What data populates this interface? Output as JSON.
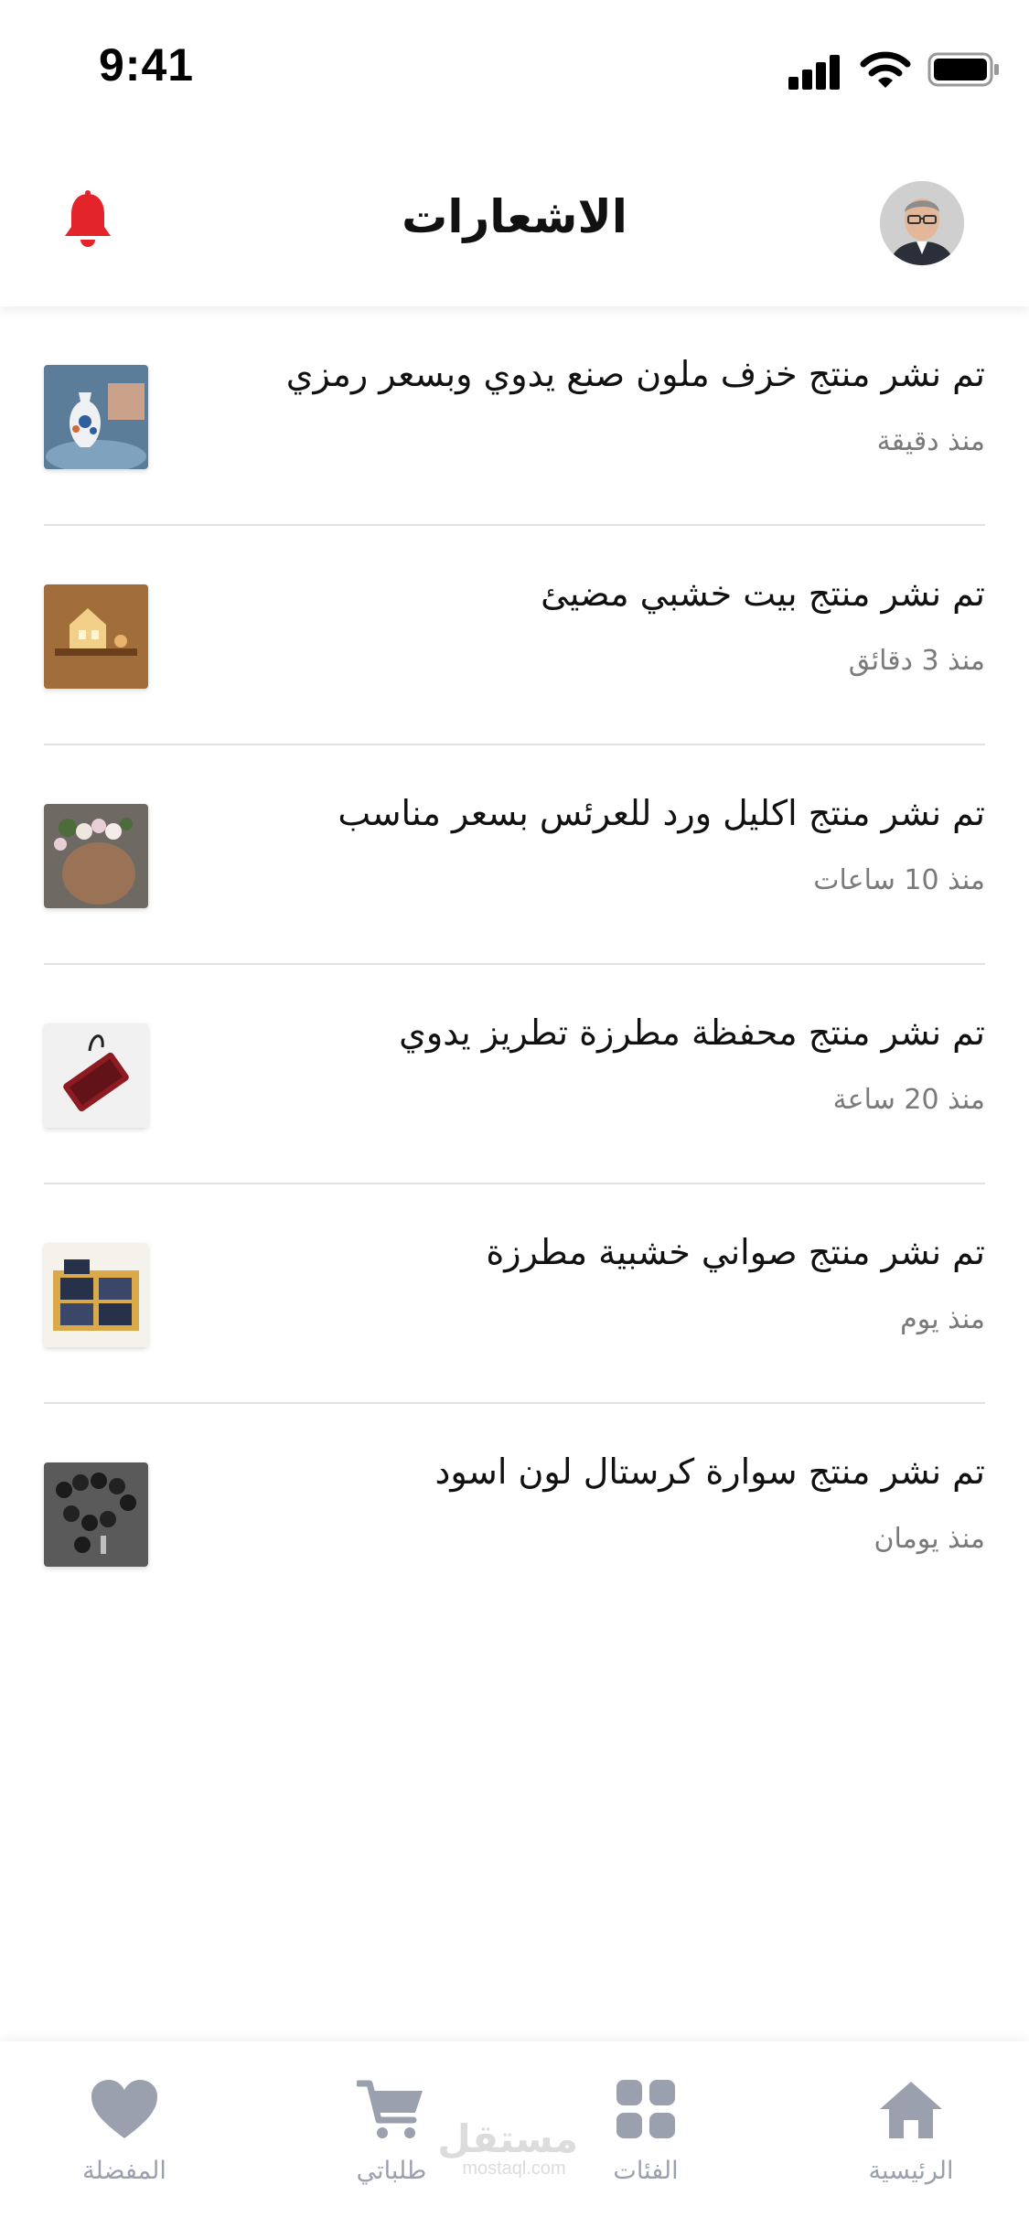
{
  "status_bar": {
    "time": "9:41"
  },
  "header": {
    "title": "الاشعارات"
  },
  "notifications": [
    {
      "title": "تم نشر منتج خزف ملون صنع يدوي وبسعر رمزي",
      "time": "منذ دقيقة",
      "thumb": "pottery-vase"
    },
    {
      "title": "تم نشر منتج بيت خشبي مضيئ",
      "time": "منذ 3 دقائق",
      "thumb": "wooden-house-lamp"
    },
    {
      "title": "تم نشر منتج اكليل ورد للعرئس بسعر مناسب",
      "time": "منذ 10 ساعات",
      "thumb": "flower-crown"
    },
    {
      "title": "تم نشر منتج محفظة مطرزة تطريز يدوي",
      "time": "منذ 20 ساعة",
      "thumb": "embroidered-wallet"
    },
    {
      "title": "تم نشر منتج صواني خشبية مطرزة",
      "time": "منذ يوم",
      "thumb": "wooden-trays"
    },
    {
      "title": "تم نشر منتج سوارة كرستال لون اسود",
      "time": "منذ يومان",
      "thumb": "black-bracelet"
    }
  ],
  "bottom_nav": {
    "home": "الرئيسية",
    "categories": "الفئات",
    "orders": "طلباتي",
    "favorites": "المفضلة"
  },
  "watermark": {
    "arabic": "مستقل",
    "latin": "mostaql.com"
  },
  "colors": {
    "accent_red": "#e3242b",
    "nav_gray": "#9aa0ad"
  }
}
